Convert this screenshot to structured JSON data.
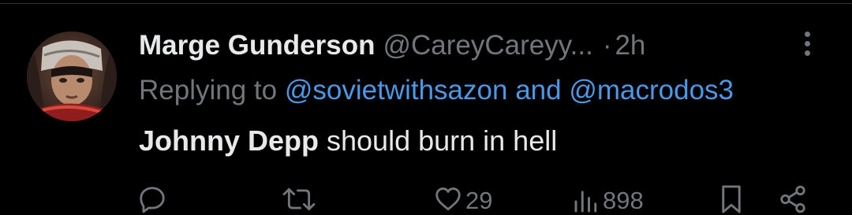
{
  "tweet": {
    "display_name": "Marge Gunderson",
    "handle": "@CareyCareyy...",
    "separator": "·",
    "time": "2h",
    "replying_prefix": "Replying to",
    "reply_to_1": "@sovietwithsazon",
    "reply_joiner": "and",
    "reply_to_2": "@macrodos3",
    "body_bold": "Johnny Depp",
    "body_rest": " should burn in hell"
  },
  "actions": {
    "reply_icon": "reply-icon",
    "retweet_icon": "retweet-icon",
    "like_icon": "heart-icon",
    "like_count": "29",
    "views_icon": "views-bar-chart-icon",
    "views_count": "898",
    "bookmark_icon": "bookmark-icon",
    "share_icon": "share-icon"
  },
  "colors": {
    "background": "#000000",
    "primary_text": "#e7e9ea",
    "secondary_text": "#71767b",
    "link": "#4a99e9"
  }
}
